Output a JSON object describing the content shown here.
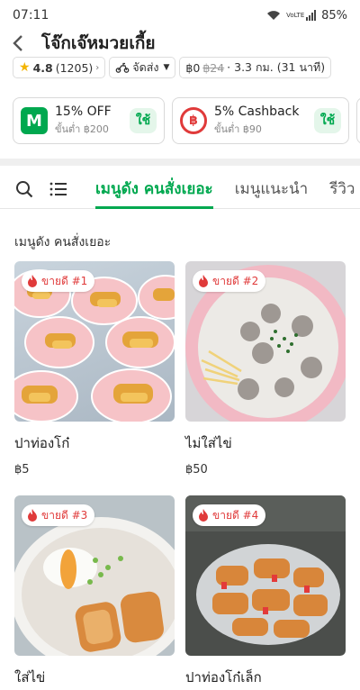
{
  "status": {
    "time": "07:11",
    "battery": "85%",
    "network": "VoLTE"
  },
  "header": {
    "title": "โจ๊กเจ๊หมวยเกี้ย"
  },
  "info": {
    "rating": "4.8",
    "reviews": "(1205)",
    "delivery_label": "จัดส่ง",
    "fee_now": "฿0",
    "fee_old": "฿24",
    "distance": "· 3.3 กม. (31 นาที)"
  },
  "promos": [
    {
      "title": "15% OFF",
      "sub": "ขั้นต่ำ ฿200",
      "button": "ใช้"
    },
    {
      "title": "5% Cashback",
      "sub": "ขั้นต่ำ ฿90",
      "button": "ใช้"
    }
  ],
  "tabs": [
    "เมนูดัง คนสั่งเยอะ",
    "เมนูแนะนำ",
    "รีวิว"
  ],
  "section": {
    "title": "เมนูดัง คนสั่งเยอะ"
  },
  "items": [
    {
      "badge": "ขายดี #1",
      "name": "ปาท่องโก๋",
      "price": "฿5"
    },
    {
      "badge": "ขายดี #2",
      "name": "ไม่ใส่ไข่",
      "price": "฿50"
    },
    {
      "badge": "ขายดี #3",
      "name": "ใส่ไข่",
      "price": ""
    },
    {
      "badge": "ขายดี #4",
      "name": "ปาท่องโก๋เล็ก",
      "price": ""
    }
  ],
  "colors": {
    "brand": "#00a84f",
    "badge": "#e03a3a",
    "star": "#f3b400"
  }
}
